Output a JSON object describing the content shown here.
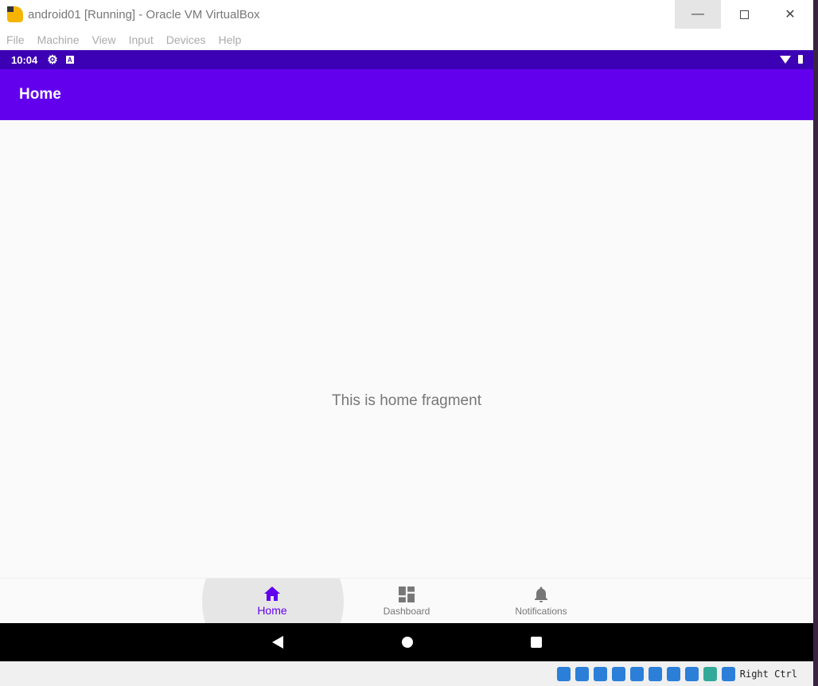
{
  "window": {
    "title": "android01 [Running] - Oracle VM VirtualBox",
    "minimize_icon": "minimize-icon",
    "maximize_icon": "maximize-icon",
    "close_icon": "close-icon"
  },
  "menu": [
    "File",
    "Machine",
    "View",
    "Input",
    "Devices",
    "Help"
  ],
  "status_bar": {
    "time": "10:04",
    "icons": [
      "gear-icon",
      "a-icon",
      "wifi-icon",
      "battery-icon"
    ]
  },
  "app_bar": {
    "title": "Home"
  },
  "content": {
    "text": "This is home fragment"
  },
  "bottom_nav": [
    {
      "label": "Home",
      "icon": "home-icon",
      "active": true
    },
    {
      "label": "Dashboard",
      "icon": "dashboard-icon"
    },
    {
      "label": "Notifications",
      "icon": "bell-icon"
    }
  ],
  "vbox_status": {
    "host_key": "Right Ctrl"
  },
  "colors": {
    "primary": "#6200EE",
    "primary_dark": "#3700B3"
  }
}
